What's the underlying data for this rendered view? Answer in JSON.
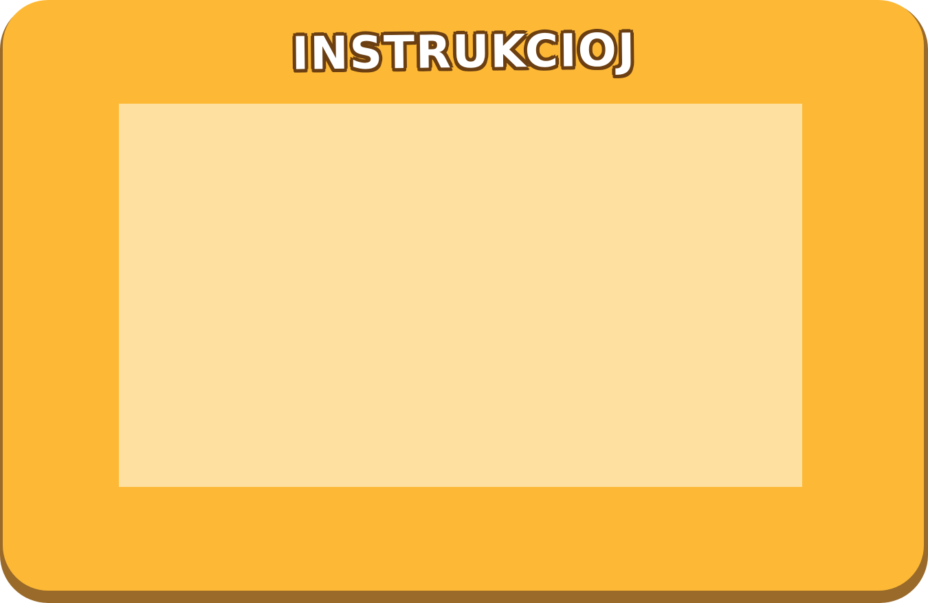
{
  "dialog": {
    "title": "INSTRUKCIOJ"
  },
  "colors": {
    "panel": "#fdb935",
    "panel_shadow": "#996a2a",
    "content_area": "#fee0a0",
    "title_fill": "#ffffff",
    "title_outline": "#6b3f12"
  }
}
